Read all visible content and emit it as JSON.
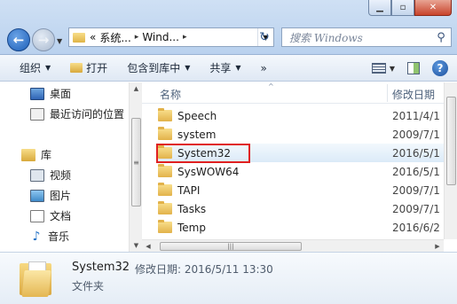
{
  "address": {
    "prefix": "«",
    "crumbs": [
      "系统...",
      "Wind..."
    ],
    "separator": "▸"
  },
  "search": {
    "placeholder": "搜索 Windows"
  },
  "toolbar": {
    "organize": "组织",
    "open": "打开",
    "include_in_library": "包含到库中",
    "share": "共享",
    "more": "»"
  },
  "nav": {
    "items": [
      {
        "label": "桌面",
        "icon": "desktop-icon"
      },
      {
        "label": "最近访问的位置",
        "icon": "recent-places-icon"
      },
      {
        "label": "库",
        "icon": "library-icon"
      },
      {
        "label": "视频",
        "icon": "video-icon"
      },
      {
        "label": "图片",
        "icon": "pictures-icon"
      },
      {
        "label": "文档",
        "icon": "documents-icon"
      },
      {
        "label": "音乐",
        "icon": "music-icon"
      }
    ]
  },
  "list": {
    "col_name": "名称",
    "col_date": "修改日期",
    "rows": [
      {
        "name": "Speech",
        "date": "2011/4/1"
      },
      {
        "name": "system",
        "date": "2009/7/1"
      },
      {
        "name": "System32",
        "date": "2016/5/1"
      },
      {
        "name": "SysWOW64",
        "date": "2016/5/1"
      },
      {
        "name": "TAPI",
        "date": "2009/7/1"
      },
      {
        "name": "Tasks",
        "date": "2009/7/1"
      },
      {
        "name": "Temp",
        "date": "2016/6/2"
      }
    ],
    "selected_index": 2
  },
  "details": {
    "name": "System32",
    "meta": "修改日期: 2016/5/11 13:30",
    "type": "文件夹"
  },
  "colors": {
    "highlight": "#e02020",
    "selection": "#dbeaf8"
  }
}
